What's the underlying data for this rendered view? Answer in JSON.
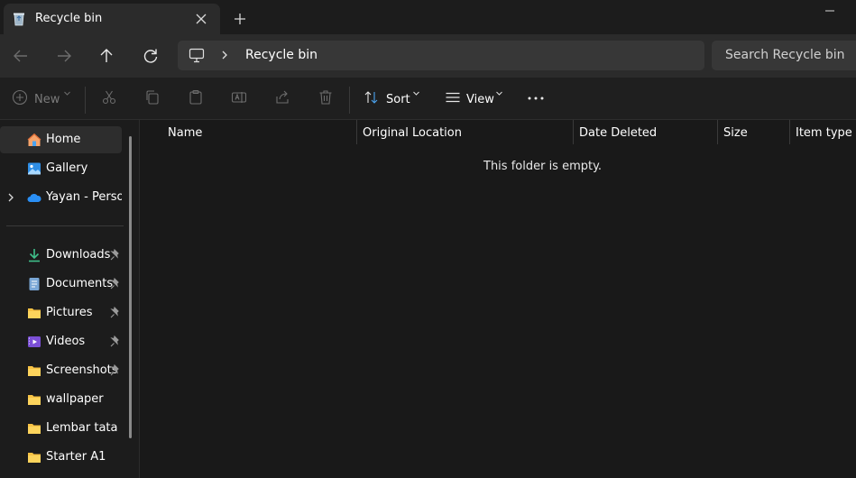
{
  "tab": {
    "title": "Recycle bin",
    "close_icon": "close-icon"
  },
  "address": {
    "breadcrumb": "Recycle bin"
  },
  "search": {
    "placeholder": "Search Recycle bin"
  },
  "commandbar": {
    "new_label": "New",
    "sort_label": "Sort",
    "view_label": "View"
  },
  "sidebar": {
    "items": [
      {
        "label": "Home",
        "icon": "home-icon",
        "selected": true
      },
      {
        "label": "Gallery",
        "icon": "gallery-icon"
      },
      {
        "label": "Yayan - Persor",
        "icon": "onedrive-icon",
        "expandable": true
      },
      {
        "label": "Downloads",
        "icon": "download-icon",
        "pinned": true
      },
      {
        "label": "Documents",
        "icon": "documents-icon",
        "pinned": true
      },
      {
        "label": "Pictures",
        "icon": "folder-icon",
        "pinned": true
      },
      {
        "label": "Videos",
        "icon": "videos-icon",
        "pinned": true
      },
      {
        "label": "Screenshots",
        "icon": "folder-icon",
        "pinned": true
      },
      {
        "label": "wallpaper",
        "icon": "folder-icon"
      },
      {
        "label": "Lembar tata ba",
        "icon": "folder-icon"
      },
      {
        "label": "Starter A1",
        "icon": "folder-icon"
      }
    ]
  },
  "columns": [
    "Name",
    "Original Location",
    "Date Deleted",
    "Size",
    "Item type"
  ],
  "content": {
    "empty_message": "This folder is empty."
  },
  "colors": {
    "titlebar": "#1c1c1c",
    "tab": "#2b2b2b",
    "address_field": "#373737",
    "accent_blue": "#4aa3f0",
    "folder_yellow": "#f7c244"
  }
}
